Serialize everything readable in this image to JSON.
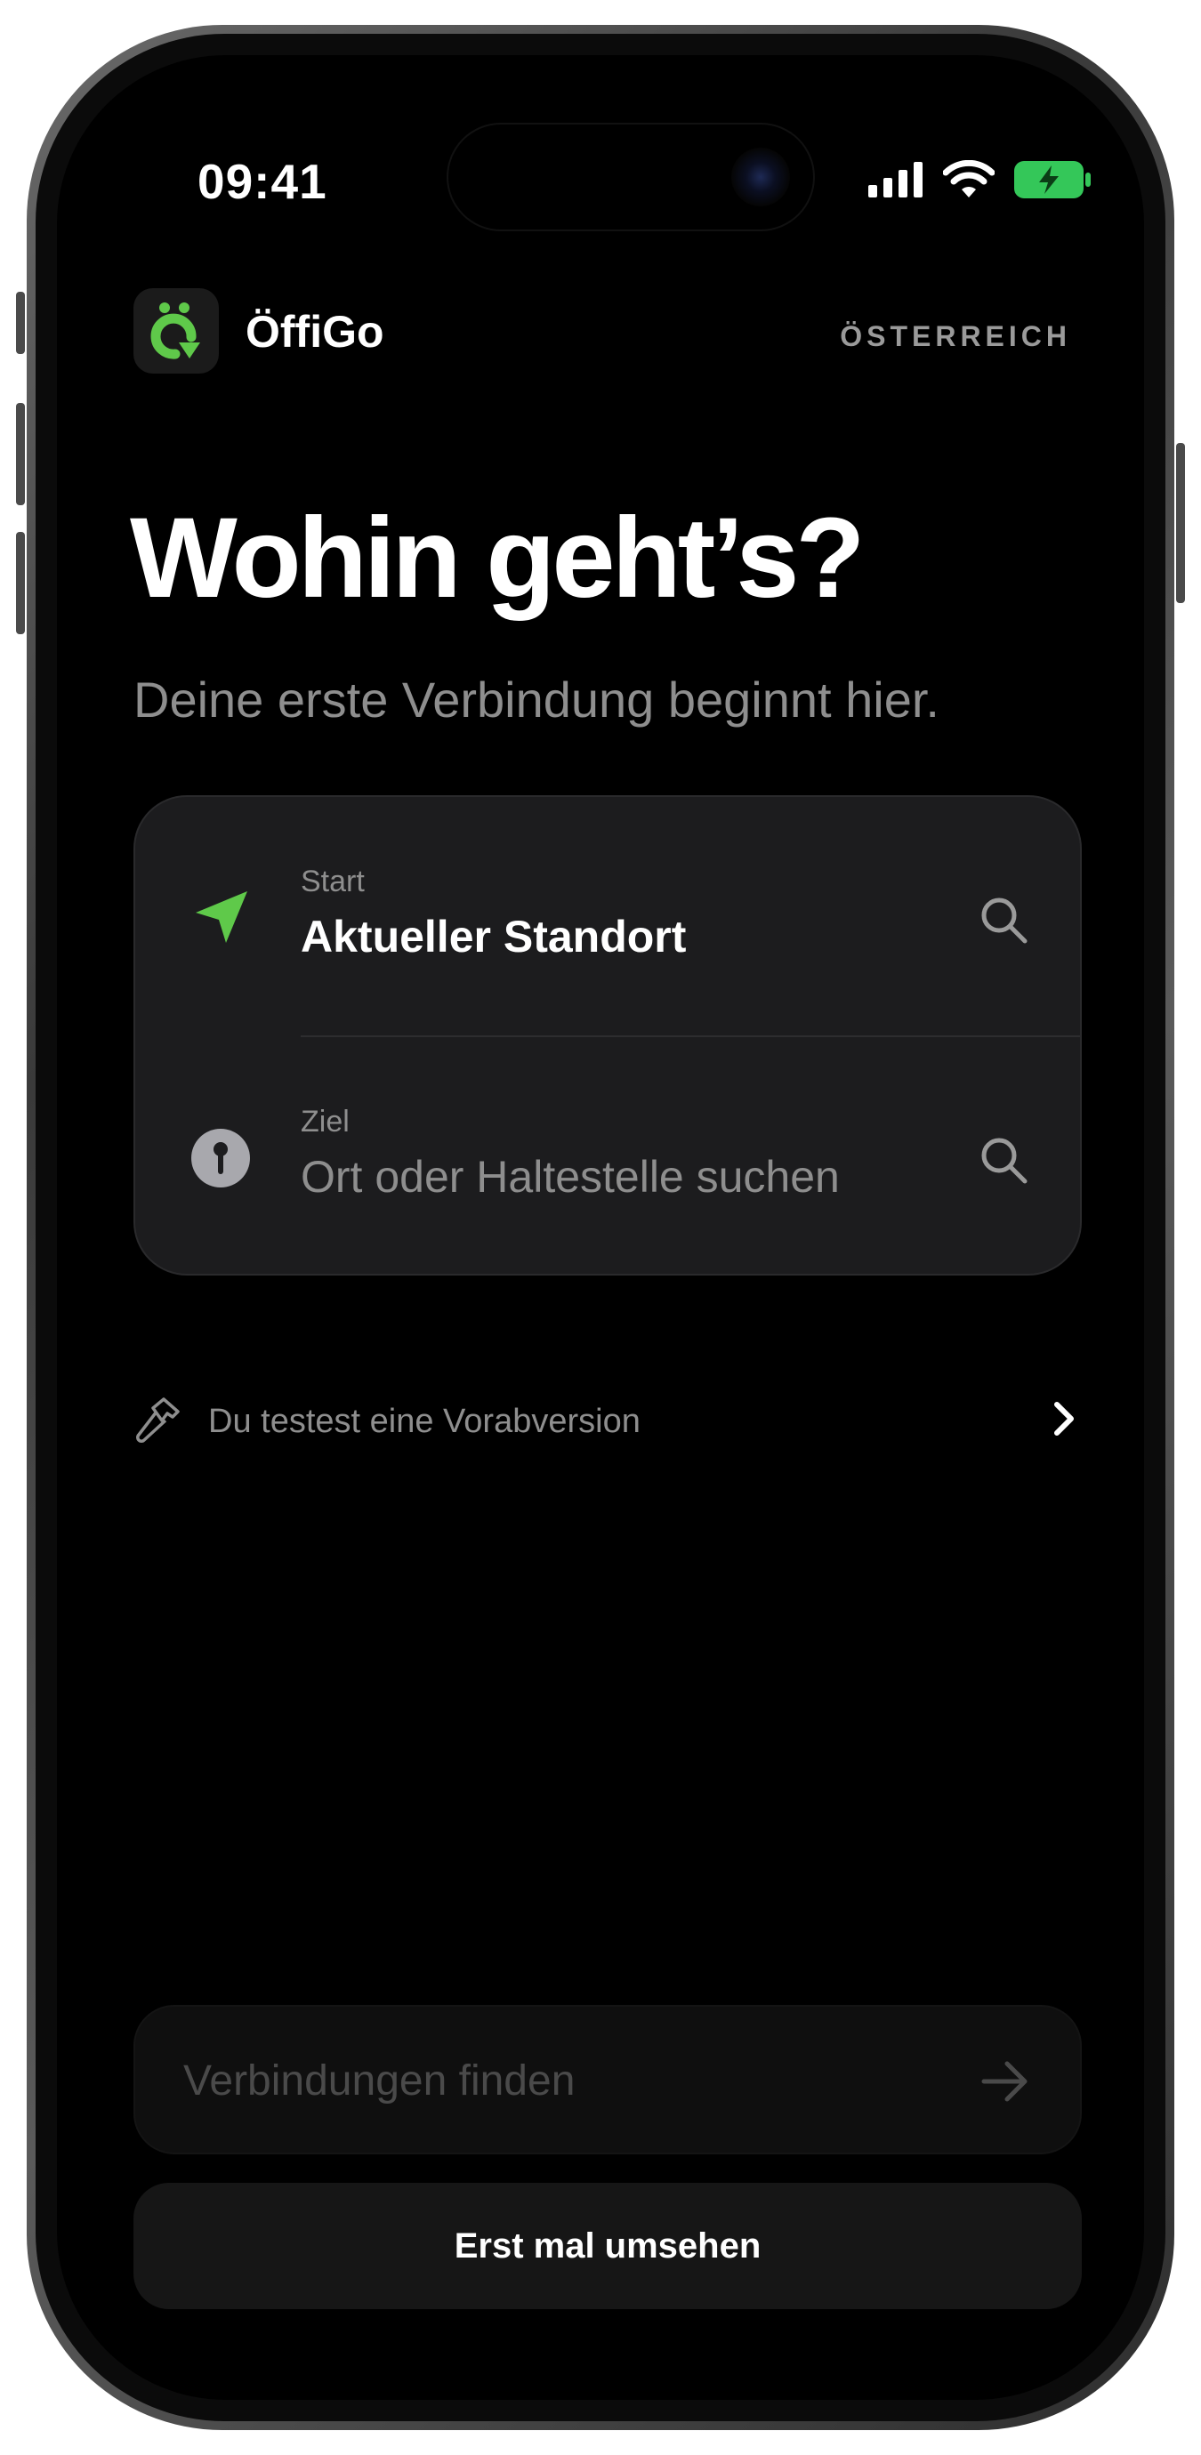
{
  "status_bar": {
    "time": "09:41",
    "icons": [
      "cellular-signal-icon",
      "wifi-icon",
      "battery-charging-icon"
    ],
    "battery_color": "#34c759"
  },
  "header": {
    "app_name": "ÖffiGo",
    "logo_icon": "oeffigo-logo-icon",
    "region": "ÖSTERREICH"
  },
  "hero": {
    "title": "Wohin geht’s?",
    "subtitle": "Deine erste Verbindung beginnt hier."
  },
  "route_card": {
    "start": {
      "label": "Start",
      "value": "Aktueller Standort",
      "icon": "location-arrow-icon"
    },
    "destination": {
      "label": "Ziel",
      "placeholder": "Ort oder Haltestelle suchen",
      "icon": "pin-icon"
    }
  },
  "prerelease": {
    "text": "Du testest eine Vorabversion",
    "icon": "hammer-icon"
  },
  "actions": {
    "find_label": "Verbindungen finden",
    "browse_label": "Erst mal umsehen"
  },
  "colors": {
    "accent": "#5fc94a",
    "background": "#000000",
    "card": "#1c1c1e",
    "muted_text": "#8e8e8e"
  }
}
